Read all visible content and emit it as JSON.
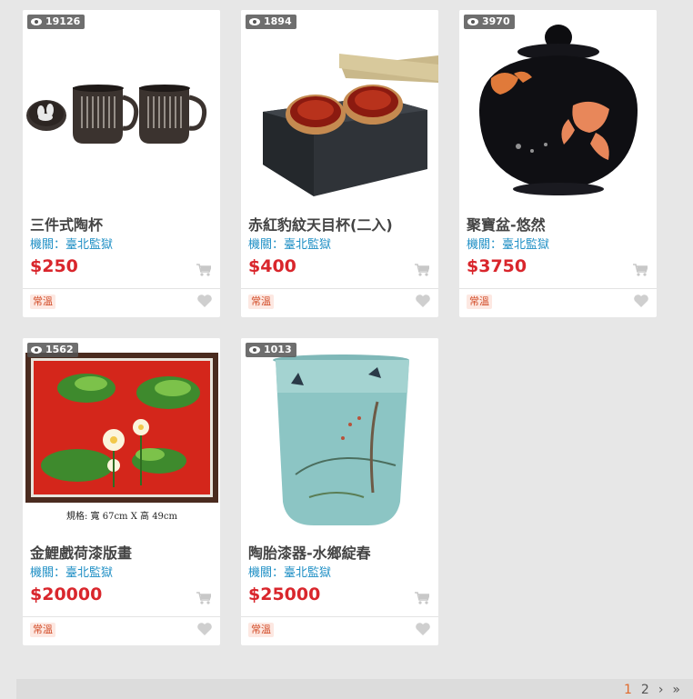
{
  "products": [
    {
      "views": "19126",
      "title": "三件式陶杯",
      "agency": "機關：臺北監獄",
      "price": "$250",
      "tag": "常溫",
      "image": "mugs"
    },
    {
      "views": "1894",
      "title": "赤紅豹紋天目杯(二入)",
      "agency": "機關：臺北監獄",
      "price": "$400",
      "tag": "常溫",
      "image": "red-cups-box"
    },
    {
      "views": "3970",
      "title": "聚寶盆-悠然",
      "agency": "機關：臺北監獄",
      "price": "$3750",
      "tag": "常溫",
      "image": "goldfish-jar"
    },
    {
      "views": "1562",
      "title": "金鯉戲荷漆版畫",
      "agency": "機關：臺北監獄",
      "price": "$20000",
      "tag": "常溫",
      "image": "lotus-painting",
      "image_caption": "規格: 寬 67cm X 高 49cm"
    },
    {
      "views": "1013",
      "title": "陶胎漆器-水鄉綻春",
      "agency": "機關：臺北監獄",
      "price": "$25000",
      "tag": "常溫",
      "image": "blue-vase"
    }
  ],
  "pagination": {
    "pages": [
      "1",
      "2"
    ],
    "next": "›",
    "last": "»",
    "current": "1"
  },
  "colors": {
    "price": "#d9262c",
    "agency": "#1f8fc5",
    "tag_text": "#d24c28",
    "tag_bg": "#fde8e2",
    "active_page": "#e06a2c"
  },
  "icons": {
    "views": "eye-icon",
    "cart": "cart-icon",
    "favorite": "heart-icon"
  }
}
